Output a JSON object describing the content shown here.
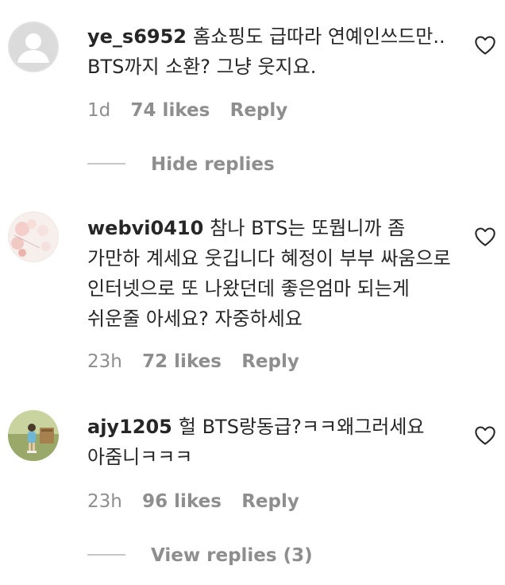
{
  "comments": [
    {
      "username": "ye_s6952",
      "text": "홈쇼핑도 급따라 연예인쓰드만.. BTS까지 소환? 그냥 웃지요.",
      "time": "1d",
      "likes": "74 likes",
      "reply": "Reply",
      "avatar": "default-avatar"
    },
    {
      "username": "webvi0410",
      "text": "참나 BTS는 또뭡니까 좀 가만하 계세요 웃깁니다 혜정이 부부 싸움으로 인터넷으로 또 나왔던데 좋은엄마 되는게 쉬운줄 아세요? 자중하세요",
      "time": "23h",
      "likes": "72 likes",
      "reply": "Reply",
      "avatar": "flower-avatar"
    },
    {
      "username": "ajy1205",
      "text": "헐 BTS랑동급?ㅋㅋ왜그러세요 아줌니ㅋㅋㅋ",
      "time": "23h",
      "likes": "96 likes",
      "reply": "Reply",
      "avatar": "child-photo-avatar"
    }
  ],
  "hide_replies": "Hide replies",
  "view_replies": "View replies (3)",
  "colors": {
    "text": "#262626",
    "muted": "#8e8e8e",
    "line": "#c7c7c7"
  }
}
